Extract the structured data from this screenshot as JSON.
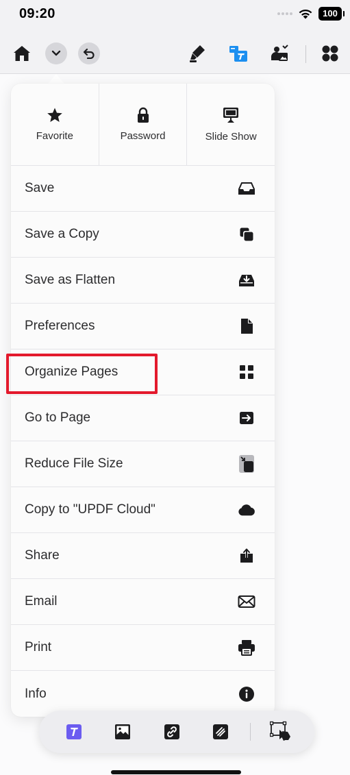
{
  "status_bar": {
    "time": "09:20",
    "battery": "100"
  },
  "toolbar": {
    "left": [
      {
        "icon": "home-icon"
      },
      {
        "icon": "chevron-down-icon"
      },
      {
        "icon": "undo-icon"
      }
    ],
    "right": [
      {
        "icon": "highlighter-icon"
      },
      {
        "icon": "text-edit-icon"
      },
      {
        "icon": "image-edit-icon"
      },
      {
        "icon": "grid-icon"
      }
    ],
    "accent_color": "#1c8ff0"
  },
  "menu": {
    "quick_actions": [
      {
        "label": "Favorite",
        "icon": "star-icon"
      },
      {
        "label": "Password",
        "icon": "lock-icon"
      },
      {
        "label": "Slide Show",
        "icon": "monitor-icon"
      }
    ],
    "items": [
      {
        "label": "Save",
        "icon": "tray-icon"
      },
      {
        "label": "Save a Copy",
        "icon": "copy-icon"
      },
      {
        "label": "Save as Flatten",
        "icon": "download-tray-icon"
      },
      {
        "label": "Preferences",
        "icon": "document-icon"
      },
      {
        "label": "Organize Pages",
        "icon": "four-squares-icon"
      },
      {
        "label": "Go to Page",
        "icon": "arrow-right-box-icon"
      },
      {
        "label": "Reduce File Size",
        "icon": "compress-icon"
      },
      {
        "label": "Copy to \"UPDF Cloud\"",
        "icon": "cloud-icon"
      },
      {
        "label": "Share",
        "icon": "share-icon"
      },
      {
        "label": "Email",
        "icon": "envelope-icon"
      },
      {
        "label": "Print",
        "icon": "printer-icon"
      },
      {
        "label": "Info",
        "icon": "info-icon"
      }
    ],
    "highlight_color": "#e3192c"
  },
  "bottom_toolbar": {
    "items": [
      {
        "icon": "text-tool-icon"
      },
      {
        "icon": "image-tool-icon"
      },
      {
        "icon": "link-tool-icon"
      },
      {
        "icon": "crop-tool-icon"
      },
      {
        "icon": "select-tool-icon"
      }
    ],
    "accent_color": "#6b5cf0"
  }
}
